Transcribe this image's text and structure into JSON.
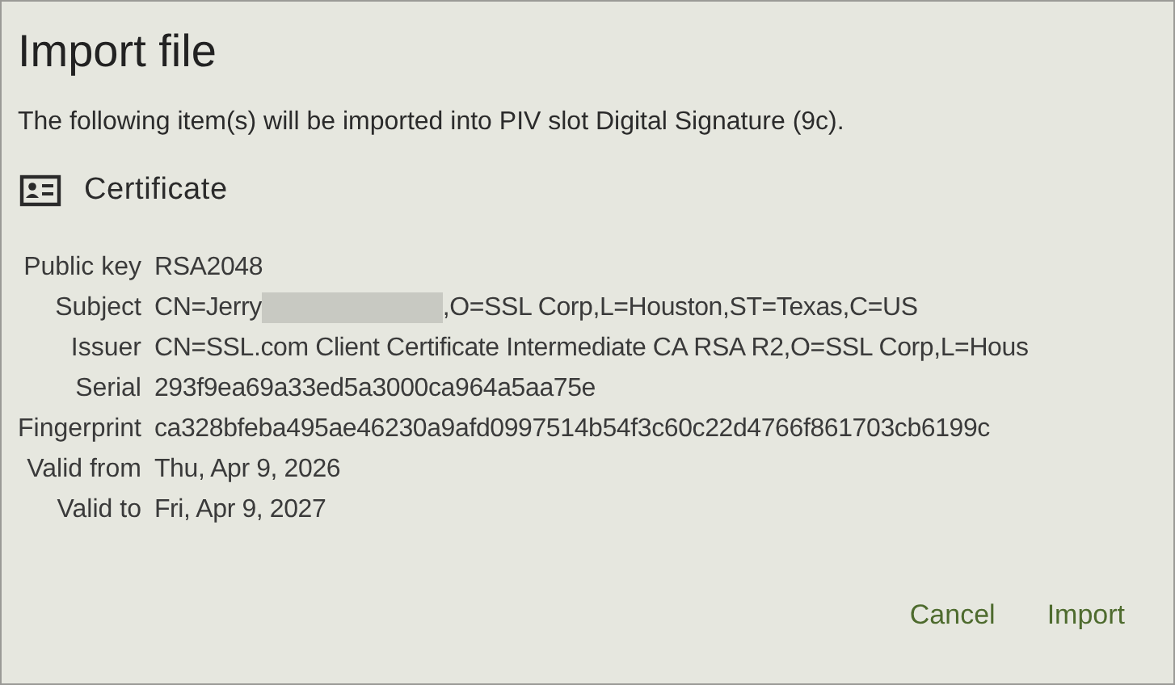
{
  "title": "Import file",
  "message": "The following item(s) will be imported into PIV slot Digital Signature (9c).",
  "section": {
    "title": "Certificate"
  },
  "rows": [
    {
      "label": "Public key",
      "value": "RSA2048"
    },
    {
      "label": "Subject",
      "value": "CN=Jerry",
      "redacted": true,
      "value_after": ",O=SSL Corp,L=Houston,ST=Texas,C=US"
    },
    {
      "label": "Issuer",
      "value": "CN=SSL.com Client Certificate Intermediate CA RSA R2,O=SSL Corp,L=Hous"
    },
    {
      "label": "Serial",
      "value": "293f9ea69a33ed5a3000ca964a5aa75e"
    },
    {
      "label": "Fingerprint",
      "value": "ca328bfeba495ae46230a9afd0997514b54f3c60c22d4766f861703cb6199c"
    },
    {
      "label": "Valid from",
      "value": "Thu, Apr 9, 2026"
    },
    {
      "label": "Valid to",
      "value": "Fri, Apr 9, 2027"
    }
  ],
  "buttons": [
    "Cancel",
    "Import"
  ]
}
